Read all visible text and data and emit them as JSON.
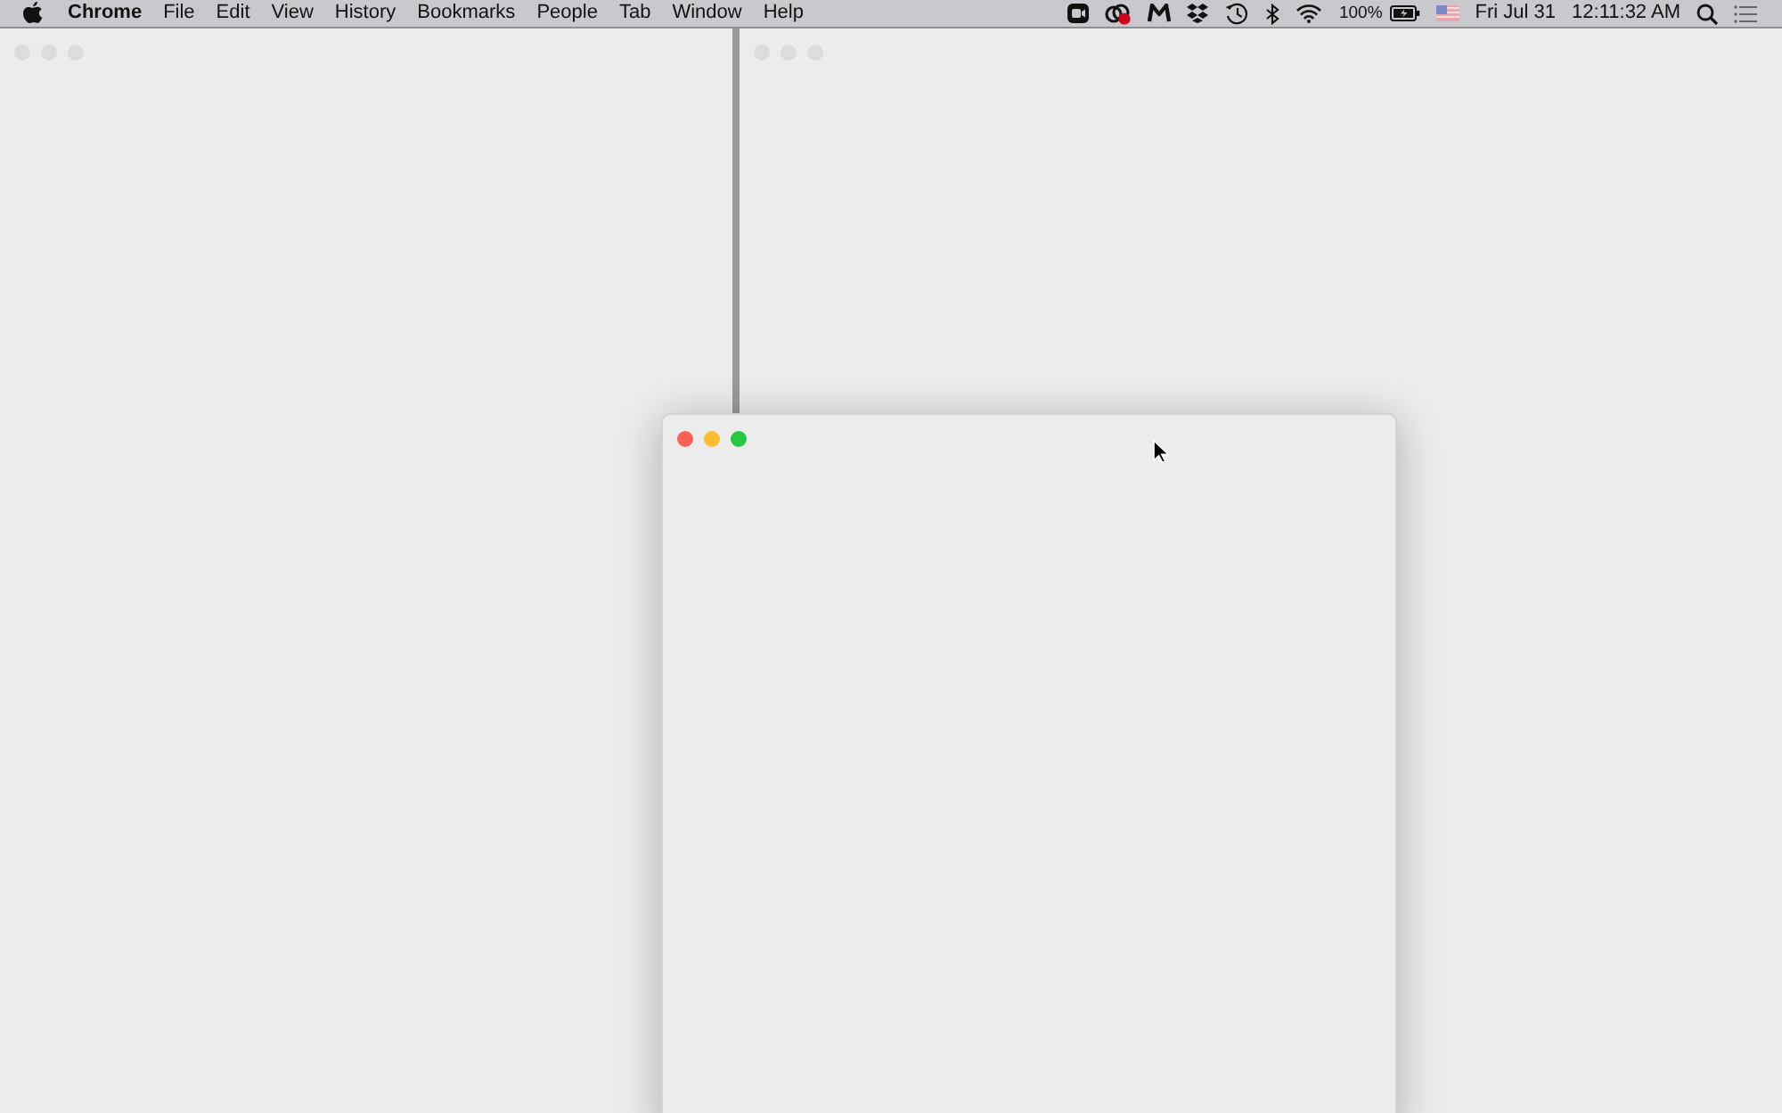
{
  "menu_bar": {
    "app_name": "Chrome",
    "menus": [
      "File",
      "Edit",
      "View",
      "History",
      "Bookmarks",
      "People",
      "Tab",
      "Window",
      "Help"
    ],
    "battery_percent": "100%",
    "date": "Fri Jul 31",
    "time": "12:11:32 AM"
  },
  "windows": [
    {
      "focused": false
    },
    {
      "focused": false
    },
    {
      "focused": true
    }
  ]
}
